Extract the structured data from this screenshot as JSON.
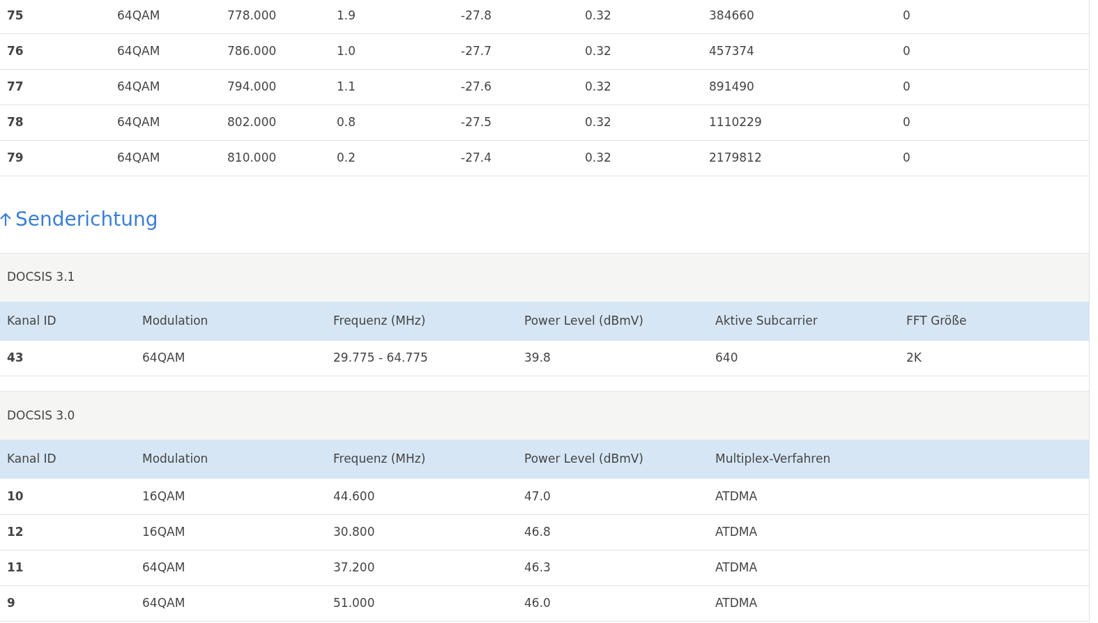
{
  "downstream_rows": [
    [
      "75",
      "64QAM",
      "778.000",
      "1.9",
      "-27.8",
      "0.32",
      "384660",
      "0"
    ],
    [
      "76",
      "64QAM",
      "786.000",
      "1.0",
      "-27.7",
      "0.32",
      "457374",
      "0"
    ],
    [
      "77",
      "64QAM",
      "794.000",
      "1.1",
      "-27.6",
      "0.32",
      "891490",
      "0"
    ],
    [
      "78",
      "64QAM",
      "802.000",
      "0.8",
      "-27.5",
      "0.32",
      "1110229",
      "0"
    ],
    [
      "79",
      "64QAM",
      "810.000",
      "0.2",
      "-27.4",
      "0.32",
      "2179812",
      "0"
    ]
  ],
  "upstream": {
    "title": "Senderichtung",
    "sections": [
      {
        "title": "DOCSIS 3.1",
        "columns": [
          "Kanal ID",
          "Modulation",
          "Frequenz (MHz)",
          "Power Level (dBmV)",
          "Aktive Subcarrier",
          "FFT Größe"
        ],
        "rows": [
          [
            "43",
            "64QAM",
            "29.775 - 64.775",
            "39.8",
            "640",
            "2K"
          ]
        ]
      },
      {
        "title": "DOCSIS 3.0",
        "columns": [
          "Kanal ID",
          "Modulation",
          "Frequenz (MHz)",
          "Power Level (dBmV)",
          "Multiplex-Verfahren"
        ],
        "rows": [
          [
            "10",
            "16QAM",
            "44.600",
            "47.0",
            "ATDMA"
          ],
          [
            "12",
            "16QAM",
            "30.800",
            "46.8",
            "ATDMA"
          ],
          [
            "11",
            "64QAM",
            "37.200",
            "46.3",
            "ATDMA"
          ],
          [
            "9",
            "64QAM",
            "51.000",
            "46.0",
            "ATDMA"
          ]
        ]
      }
    ]
  }
}
